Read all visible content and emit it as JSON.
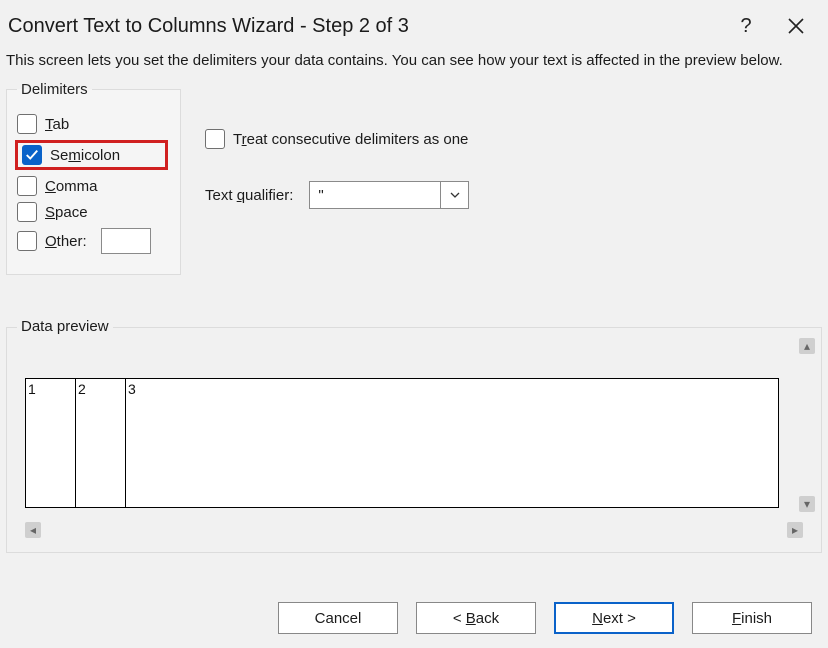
{
  "title": "Convert Text to Columns Wizard - Step 2 of 3",
  "description": "This screen lets you set the delimiters your data contains.  You can see how your text is affected in the preview below.",
  "delimiters": {
    "legend": "Delimiters",
    "tab": "Tab",
    "semicolon": "Semicolon",
    "comma": "Comma",
    "space": "Space",
    "other": "Other:",
    "other_value": ""
  },
  "consecutive_label": "Treat consecutive delimiters as one",
  "qualifier_label": "Text qualifier:",
  "qualifier_value": "\"",
  "preview_legend": "Data preview",
  "preview_cols": [
    "1",
    "2",
    "3"
  ],
  "buttons": {
    "cancel": "Cancel",
    "back": "< Back",
    "next": "Next >",
    "finish": "Finish"
  }
}
